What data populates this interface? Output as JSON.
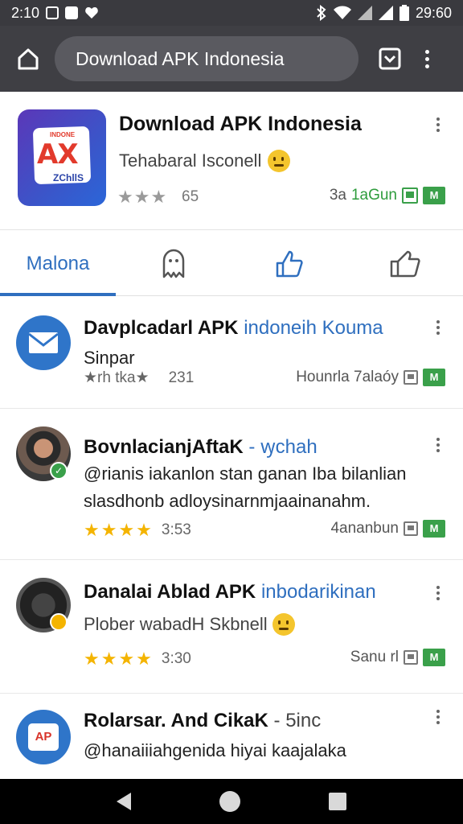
{
  "status_bar": {
    "time_left": "2:10",
    "time_right": "29:60"
  },
  "toolbar": {
    "url_text": "Download APK Indonesia"
  },
  "app_header": {
    "icon_top_text": "INDONE",
    "icon_main_text": "AX",
    "icon_sub_text": "ZChllS",
    "title": "Download APK Indonesia",
    "subtitle": "Tehabaral Isconell",
    "stars": "★★★",
    "rating_count": "65",
    "meta_prefix": "3a",
    "meta_green": "1aGun",
    "badge": "M"
  },
  "tabs": [
    {
      "label": "Malona",
      "icon": "text-tab",
      "active": true
    },
    {
      "label": "",
      "icon": "ghost-icon",
      "active": false
    },
    {
      "label": "",
      "icon": "thumbs-up-outline-blue-icon",
      "active": false
    },
    {
      "label": "",
      "icon": "thumbs-up-outline-gray-icon",
      "active": false
    }
  ],
  "items": [
    {
      "title": "Davplcadarl APK",
      "title_accent": "indoneih Kouma",
      "body": "Sinpar",
      "rating_text": "★rh tka★",
      "time": "231",
      "meta": "Hounrla 7alaóy",
      "badge": "M",
      "avatar_icon": "mail-icon"
    },
    {
      "title": "BovnlacianjAftaK",
      "title_accent": "- ꝡchah",
      "body": "@rianis iakanlon stan ganan Iba bilanlian",
      "body2": "slasdhonb adloysinarnmjaainanahm.",
      "stars": "★★★★",
      "time": "3:53",
      "meta": "4ananbun",
      "badge": "M",
      "avatar_icon": "person-photo"
    },
    {
      "title": "Danalai Ablad APK",
      "title_accent": "inbodarikinan",
      "body": "Plober wabadH Skbnell",
      "stars": "★★★★",
      "time": "3:30",
      "meta": "Sanu rl",
      "badge": "M",
      "avatar_icon": "phone-photo"
    },
    {
      "title": "Rolarsar. And CikaK",
      "title_accent": "- 5inc",
      "body": "@hanaiiiahgenida hiyai kaajalaka",
      "avatar_text": "AP",
      "avatar_icon": "apk-app-icon"
    }
  ]
}
